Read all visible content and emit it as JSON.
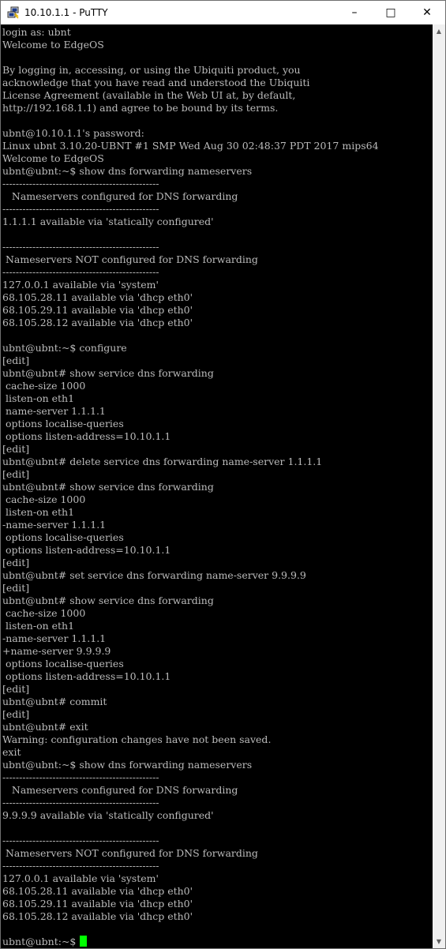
{
  "window": {
    "title": "10.10.1.1 - PuTTY",
    "icon": "putty-icon",
    "controls": {
      "minimize_glyph": "–",
      "maximize_glyph": "□",
      "close_glyph": "✕"
    }
  },
  "colors": {
    "terminal_bg": "#000000",
    "terminal_text": "#bbbbbb",
    "cursor": "#00ff00"
  },
  "scrollbar": {
    "up_glyph": "▲",
    "down_glyph": "▼"
  },
  "terminal": {
    "lines": [
      "login as: ubnt",
      "Welcome to EdgeOS",
      "",
      "By logging in, accessing, or using the Ubiquiti product, you",
      "acknowledge that you have read and understood the Ubiquiti",
      "License Agreement (available in the Web UI at, by default,",
      "http://192.168.1.1) and agree to be bound by its terms.",
      "",
      "ubnt@10.10.1.1's password:",
      "Linux ubnt 3.10.20-UBNT #1 SMP Wed Aug 30 02:48:37 PDT 2017 mips64",
      "Welcome to EdgeOS",
      "ubnt@ubnt:~$ show dns forwarding nameservers",
      "-----------------------------------------------",
      "   Nameservers configured for DNS forwarding",
      "-----------------------------------------------",
      "1.1.1.1 available via 'statically configured'",
      "",
      "-----------------------------------------------",
      " Nameservers NOT configured for DNS forwarding",
      "-----------------------------------------------",
      "127.0.0.1 available via 'system'",
      "68.105.28.11 available via 'dhcp eth0'",
      "68.105.29.11 available via 'dhcp eth0'",
      "68.105.28.12 available via 'dhcp eth0'",
      "",
      "ubnt@ubnt:~$ configure",
      "[edit]",
      "ubnt@ubnt# show service dns forwarding",
      " cache-size 1000",
      " listen-on eth1",
      " name-server 1.1.1.1",
      " options localise-queries",
      " options listen-address=10.10.1.1",
      "[edit]",
      "ubnt@ubnt# delete service dns forwarding name-server 1.1.1.1",
      "[edit]",
      "ubnt@ubnt# show service dns forwarding",
      " cache-size 1000",
      " listen-on eth1",
      "-name-server 1.1.1.1",
      " options localise-queries",
      " options listen-address=10.10.1.1",
      "[edit]",
      "ubnt@ubnt# set service dns forwarding name-server 9.9.9.9",
      "[edit]",
      "ubnt@ubnt# show service dns forwarding",
      " cache-size 1000",
      " listen-on eth1",
      "-name-server 1.1.1.1",
      "+name-server 9.9.9.9",
      " options localise-queries",
      " options listen-address=10.10.1.1",
      "[edit]",
      "ubnt@ubnt# commit",
      "[edit]",
      "ubnt@ubnt# exit",
      "Warning: configuration changes have not been saved.",
      "exit",
      "ubnt@ubnt:~$ show dns forwarding nameservers",
      "-----------------------------------------------",
      "   Nameservers configured for DNS forwarding",
      "-----------------------------------------------",
      "9.9.9.9 available via 'statically configured'",
      "",
      "-----------------------------------------------",
      " Nameservers NOT configured for DNS forwarding",
      "-----------------------------------------------",
      "127.0.0.1 available via 'system'",
      "68.105.28.11 available via 'dhcp eth0'",
      "68.105.29.11 available via 'dhcp eth0'",
      "68.105.28.12 available via 'dhcp eth0'",
      "",
      "ubnt@ubnt:~$ "
    ]
  }
}
